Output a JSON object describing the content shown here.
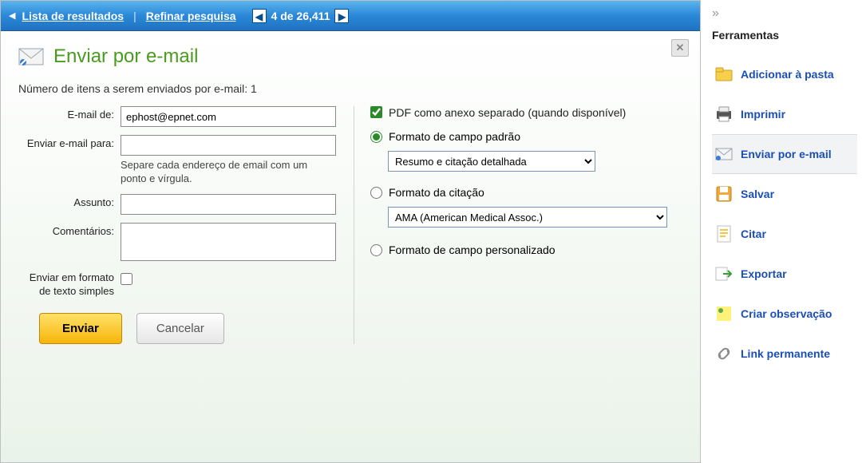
{
  "topbar": {
    "results_link": "Lista de resultados",
    "refine_link": "Refinar pesquisa",
    "pager_text": "4 de 26,411"
  },
  "dialog": {
    "title": "Enviar por e-mail",
    "item_count_text": "Número de itens a serem enviados por e-mail: 1",
    "labels": {
      "from": "E-mail de:",
      "to": "Enviar e-mail para:",
      "to_hint": "Separe cada endereço de email com um ponto e vírgula.",
      "subject": "Assunto:",
      "comments": "Comentários:",
      "plaintext": "Enviar em formato de texto simples"
    },
    "values": {
      "from": "ephost@epnet.com",
      "to": "",
      "subject": "",
      "comments": "",
      "plaintext_checked": false
    },
    "attach": {
      "pdf_label": "PDF como anexo separado (quando disponível)",
      "pdf_checked": true,
      "opt_standard": "Formato de campo padrão",
      "standard_select": "Resumo e citação detalhada",
      "opt_citation": "Formato da citação",
      "citation_select": "AMA (American Medical Assoc.)",
      "opt_custom": "Formato de campo personalizado",
      "selected": "standard"
    },
    "buttons": {
      "send": "Enviar",
      "cancel": "Cancelar"
    }
  },
  "sidebar": {
    "title": "Ferramentas",
    "items": [
      {
        "id": "add-folder",
        "label": "Adicionar à pasta"
      },
      {
        "id": "print",
        "label": "Imprimir"
      },
      {
        "id": "email",
        "label": "Enviar por e-mail",
        "active": true
      },
      {
        "id": "save",
        "label": "Salvar"
      },
      {
        "id": "cite",
        "label": "Citar"
      },
      {
        "id": "export",
        "label": "Exportar"
      },
      {
        "id": "note",
        "label": "Criar observação"
      },
      {
        "id": "permalink",
        "label": "Link permanente"
      }
    ]
  }
}
